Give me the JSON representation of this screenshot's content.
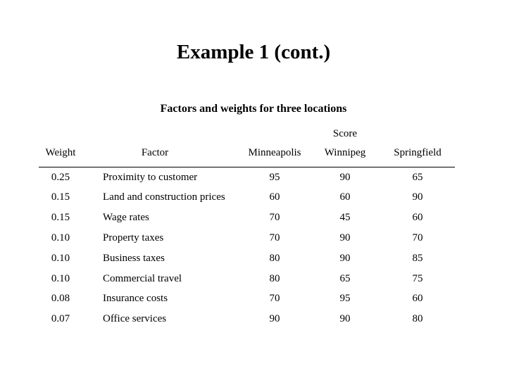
{
  "title": "Example 1 (cont.)",
  "subtitle": "Factors and weights for three locations",
  "table": {
    "group_header": "Score",
    "headers": {
      "weight": "Weight",
      "factor": "Factor",
      "minneapolis": "Minneapolis",
      "winnipeg": "Winnipeg",
      "springfield": "Springfield"
    },
    "rows": [
      {
        "weight": "0.25",
        "factor": "Proximity to customer",
        "minneapolis": "95",
        "winnipeg": "90",
        "springfield": "65"
      },
      {
        "weight": "0.15",
        "factor": "Land and construction prices",
        "minneapolis": "60",
        "winnipeg": "60",
        "springfield": "90"
      },
      {
        "weight": "0.15",
        "factor": "Wage rates",
        "minneapolis": "70",
        "winnipeg": "45",
        "springfield": "60"
      },
      {
        "weight": "0.10",
        "factor": "Property taxes",
        "minneapolis": "70",
        "winnipeg": "90",
        "springfield": "70"
      },
      {
        "weight": "0.10",
        "factor": "Business taxes",
        "minneapolis": "80",
        "winnipeg": "90",
        "springfield": "85"
      },
      {
        "weight": "0.10",
        "factor": "Commercial travel",
        "minneapolis": "80",
        "winnipeg": "65",
        "springfield": "75"
      },
      {
        "weight": "0.08",
        "factor": "Insurance costs",
        "minneapolis": "70",
        "winnipeg": "95",
        "springfield": "60"
      },
      {
        "weight": "0.07",
        "factor": "Office services",
        "minneapolis": "90",
        "winnipeg": "90",
        "springfield": "80"
      }
    ]
  }
}
